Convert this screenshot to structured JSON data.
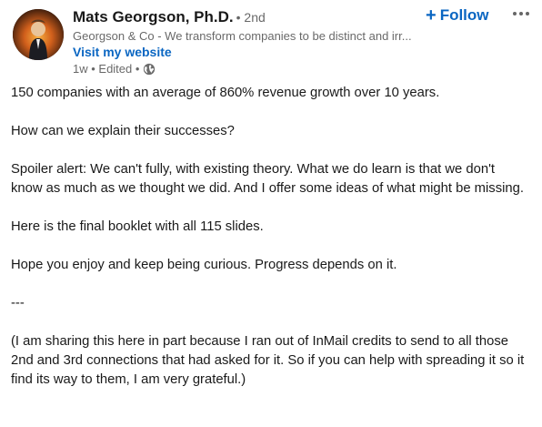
{
  "post": {
    "author": {
      "name": "Mats Georgson, Ph.D.",
      "degree": "• 2nd",
      "headline": "Georgson & Co - We transform companies to be distinct and irr...",
      "website_label": "Visit my website",
      "meta": "1w • Edited •",
      "avatar_icon": "avatar-photo",
      "visibility_icon": "globe-icon"
    },
    "actions": {
      "follow_label": "Follow",
      "follow_icon": "plus-icon",
      "more_icon": "ellipsis-icon"
    },
    "body": [
      "150 companies with an average of 860% revenue growth over 10 years.",
      "How can we explain their successes?",
      "Spoiler alert: We can't fully, with existing theory. What we do learn is that we don't know as much as we thought we did. And I offer some ideas of what might be missing.",
      "Here is the final booklet with all 115 slides.",
      "Hope you enjoy and keep being curious. Progress depends on it.",
      "---",
      "(I am sharing this here in part because I ran out of InMail credits to send to all those 2nd and 3rd connections that had asked for it. So if you can help with spreading it so it find its way to them, I am very grateful.)"
    ]
  },
  "colors": {
    "link_blue": "#0a66c2",
    "text_primary": "rgba(0,0,0,0.9)",
    "text_secondary": "rgba(0,0,0,0.6)"
  }
}
